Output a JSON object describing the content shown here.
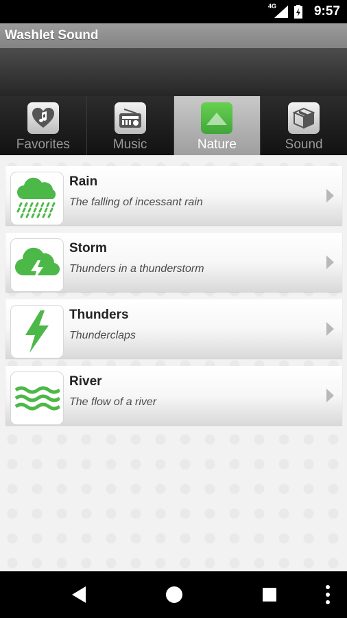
{
  "status": {
    "network": "4G",
    "time": "9:57"
  },
  "app": {
    "title": "Washlet Sound"
  },
  "tabs": [
    {
      "label": "Favorites",
      "icon": "heart-music-icon",
      "active": false
    },
    {
      "label": "Music",
      "icon": "radio-icon",
      "active": false
    },
    {
      "label": "Nature",
      "icon": "mountain-icon",
      "active": true
    },
    {
      "label": "Sound",
      "icon": "box-icon",
      "active": false
    }
  ],
  "items": [
    {
      "title": "Rain",
      "subtitle": "The falling of incessant rain",
      "icon": "rain-cloud-icon"
    },
    {
      "title": "Storm",
      "subtitle": "Thunders in a thunderstorm",
      "icon": "storm-cloud-icon"
    },
    {
      "title": "Thunders",
      "subtitle": "Thunderclaps",
      "icon": "lightning-icon"
    },
    {
      "title": "River",
      "subtitle": "The flow of a river",
      "icon": "waves-icon"
    }
  ],
  "colors": {
    "accent_green": "#4cb848",
    "active_tab": "#b5b5b5"
  }
}
